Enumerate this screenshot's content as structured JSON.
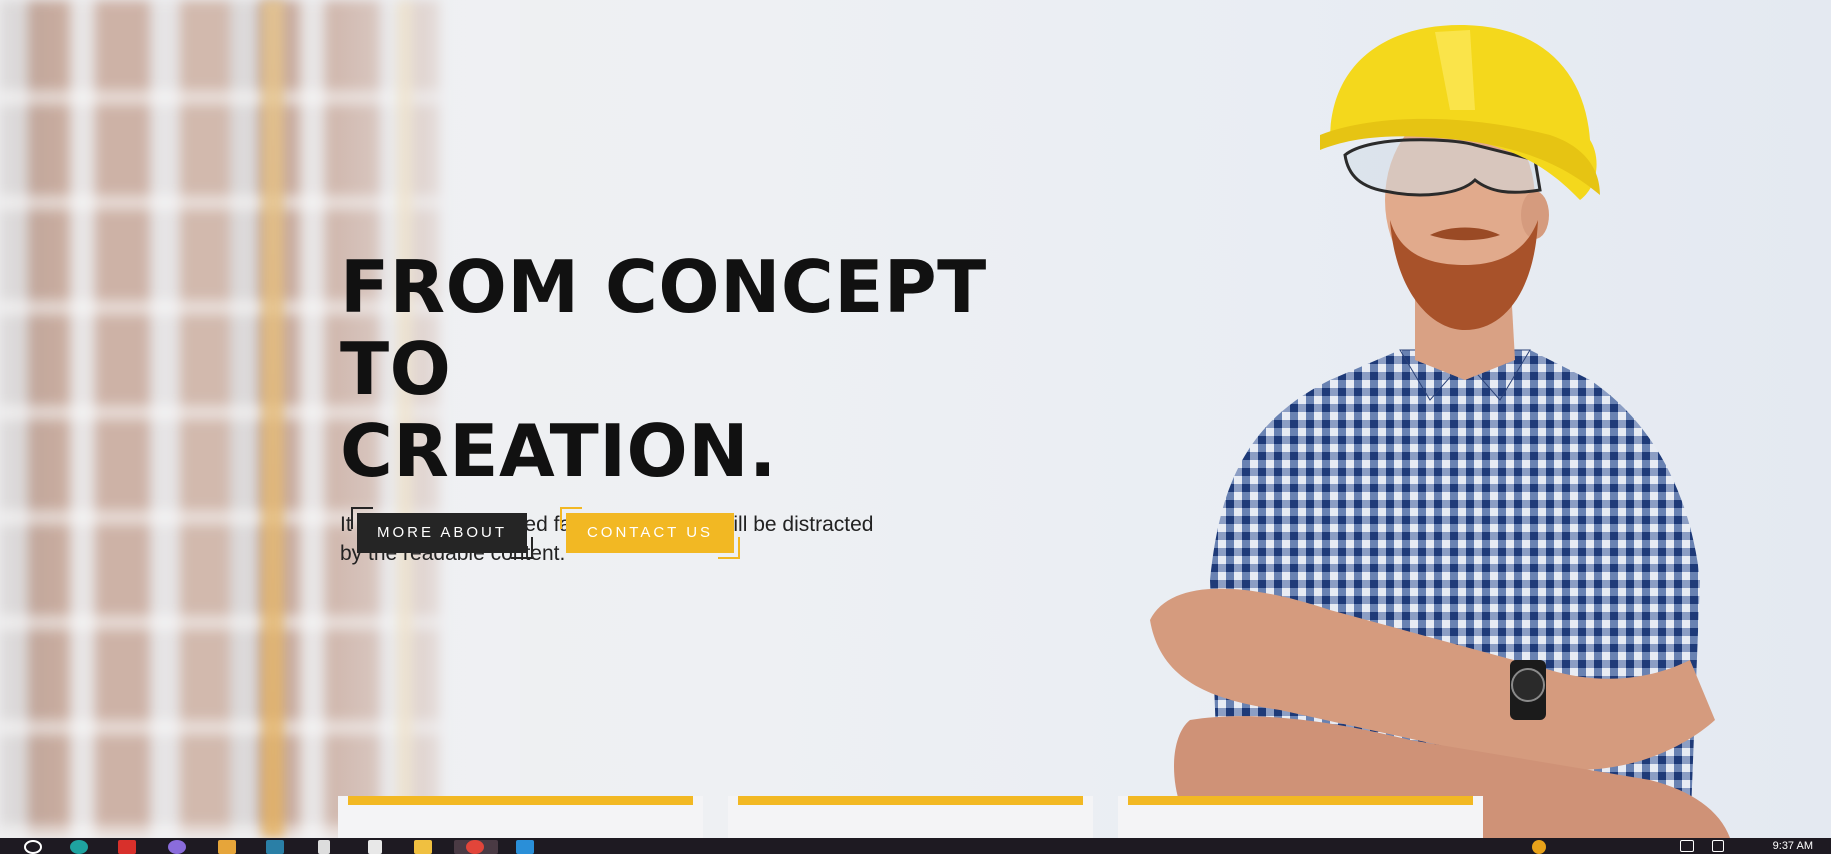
{
  "hero": {
    "title_line1": "FROM CONCEPT TO",
    "title_line2": "CREATION.",
    "subtitle_line1": "It is a long established fact that a reader will be distracted",
    "subtitle_line2": "by the readable content."
  },
  "buttons": {
    "more_about": "MORE ABOUT",
    "contact_us": "CONTACT US"
  },
  "colors": {
    "accent": "#f2b823",
    "dark": "#252525",
    "text": "#111111"
  },
  "taskbar": {
    "icons": [
      "search-icon",
      "edge-icon",
      "app-red-icon",
      "app-purple-icon",
      "file-explorer-icon",
      "terminal-icon",
      "document-icon",
      "notepad-icon",
      "folder-icon",
      "chrome-icon",
      "vscode-icon"
    ],
    "clock": "9:37 AM"
  }
}
